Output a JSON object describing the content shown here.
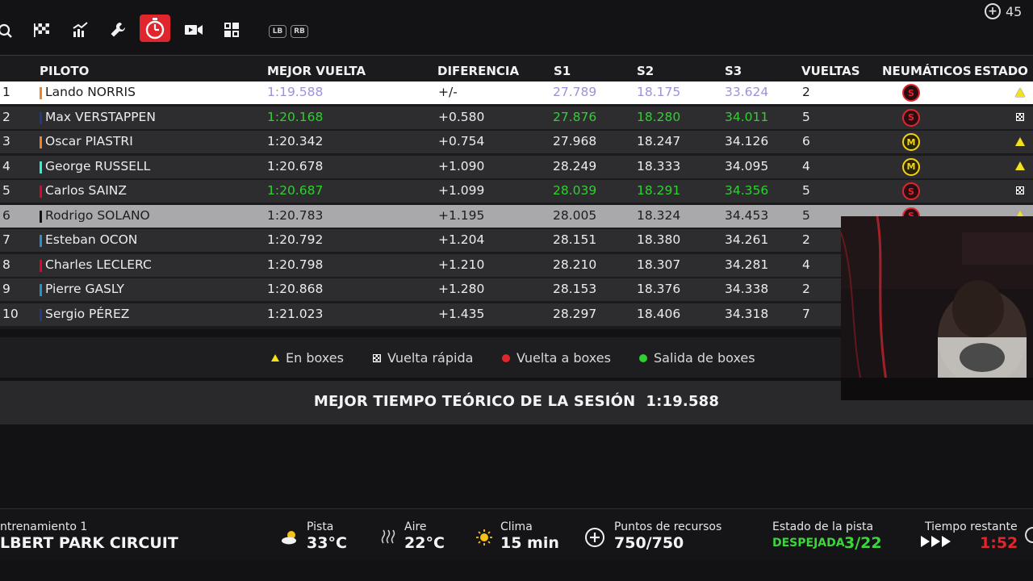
{
  "top_tabs": [
    {
      "icon": "magnifier-icon"
    },
    {
      "icon": "checkered-flag-icon"
    },
    {
      "icon": "chart-icon"
    },
    {
      "icon": "wrench-icon"
    },
    {
      "icon": "stopwatch-icon",
      "active": true
    },
    {
      "icon": "video-icon"
    },
    {
      "icon": "grid-icon"
    }
  ],
  "shoulder_buttons": {
    "left": "LB",
    "right": "RB"
  },
  "topright_value": "45",
  "table": {
    "headers": {
      "driver": "PILOTO",
      "best_lap": "MEJOR VUELTA",
      "gap": "DIFERENCIA",
      "s1": "S1",
      "s2": "S2",
      "s3": "S3",
      "laps": "VUELTAS",
      "tyres": "NEUMÁTICOS",
      "status": "ESTADO"
    },
    "rows": [
      {
        "pos": "1",
        "driver": "Lando NORRIS",
        "team_color": "#f58020",
        "best": "1:19.588",
        "gap": "+/-",
        "s1": "27.789",
        "s2": "18.175",
        "s3": "33.624",
        "laps": "2",
        "tyre": "S",
        "status": "pit"
      },
      {
        "pos": "2",
        "driver": "Max VERSTAPPEN",
        "team_color": "#1e3a8a",
        "best": "1:20.168",
        "gap": "+0.580",
        "s1": "27.876",
        "s2": "18.280",
        "s3": "34.011",
        "laps": "5",
        "tyre": "S",
        "status": "fast"
      },
      {
        "pos": "3",
        "driver": "Oscar PIASTRI",
        "team_color": "#f58020",
        "best": "1:20.342",
        "gap": "+0.754",
        "s1": "27.968",
        "s2": "18.247",
        "s3": "34.126",
        "laps": "6",
        "tyre": "M",
        "status": "pit"
      },
      {
        "pos": "4",
        "driver": "George RUSSELL",
        "team_color": "#27f4d2",
        "best": "1:20.678",
        "gap": "+1.090",
        "s1": "28.249",
        "s2": "18.333",
        "s3": "34.095",
        "laps": "4",
        "tyre": "M",
        "status": "pit"
      },
      {
        "pos": "5",
        "driver": "Carlos SAINZ",
        "team_color": "#e8002d",
        "best": "1:20.687",
        "gap": "+1.099",
        "s1": "28.039",
        "s2": "18.291",
        "s3": "34.356",
        "laps": "5",
        "tyre": "S",
        "status": "fast"
      },
      {
        "pos": "6",
        "driver": "Rodrigo SOLANO",
        "team_color": "#111111",
        "best": "1:20.783",
        "gap": "+1.195",
        "s1": "28.005",
        "s2": "18.324",
        "s3": "34.453",
        "laps": "5",
        "tyre": "S",
        "status": "pit"
      },
      {
        "pos": "7",
        "driver": "Esteban OCON",
        "team_color": "#2293d1",
        "best": "1:20.792",
        "gap": "+1.204",
        "s1": "28.151",
        "s2": "18.380",
        "s3": "34.261",
        "laps": "2",
        "tyre": "",
        "status": ""
      },
      {
        "pos": "8",
        "driver": "Charles LECLERC",
        "team_color": "#e8002d",
        "best": "1:20.798",
        "gap": "+1.210",
        "s1": "28.210",
        "s2": "18.307",
        "s3": "34.281",
        "laps": "4",
        "tyre": "",
        "status": ""
      },
      {
        "pos": "9",
        "driver": "Pierre GASLY",
        "team_color": "#2293d1",
        "best": "1:20.868",
        "gap": "+1.280",
        "s1": "28.153",
        "s2": "18.376",
        "s3": "34.338",
        "laps": "2",
        "tyre": "",
        "status": ""
      },
      {
        "pos": "10",
        "driver": "Sergio PÉREZ",
        "team_color": "#1e3a8a",
        "best": "1:21.023",
        "gap": "+1.435",
        "s1": "28.297",
        "s2": "18.406",
        "s3": "34.318",
        "laps": "7",
        "tyre": "",
        "status": ""
      }
    ]
  },
  "legend": {
    "in_pits": "En boxes",
    "fast_lap": "Vuelta rápida",
    "pit_lap": "Vuelta a boxes",
    "pit_exit": "Salida de boxes"
  },
  "theoretical": {
    "label": "MEJOR TIEMPO TEÓRICO DE LA SESIÓN",
    "value": "1:19.588"
  },
  "bottom": {
    "session": "ntrenamiento 1",
    "circuit": "LBERT PARK CIRCUIT",
    "track_label": "Pista",
    "track_value": "33°C",
    "air_label": "Aire",
    "air_value": "22°C",
    "weather_label": "Clima",
    "weather_value": "15 min",
    "resources_label": "Puntos de recursos",
    "resources_value": "750/750",
    "track_state_label": "Estado de la pista",
    "track_state_value": "DESPEJADA",
    "track_state_count": "3/22",
    "time_left_label": "Tiempo restante",
    "time_left_value": "1:52"
  },
  "colors": {
    "accent_red": "#e0262c",
    "purple": "#9b93d8",
    "green": "#2fd02f",
    "track_green": "#3bd63b"
  }
}
